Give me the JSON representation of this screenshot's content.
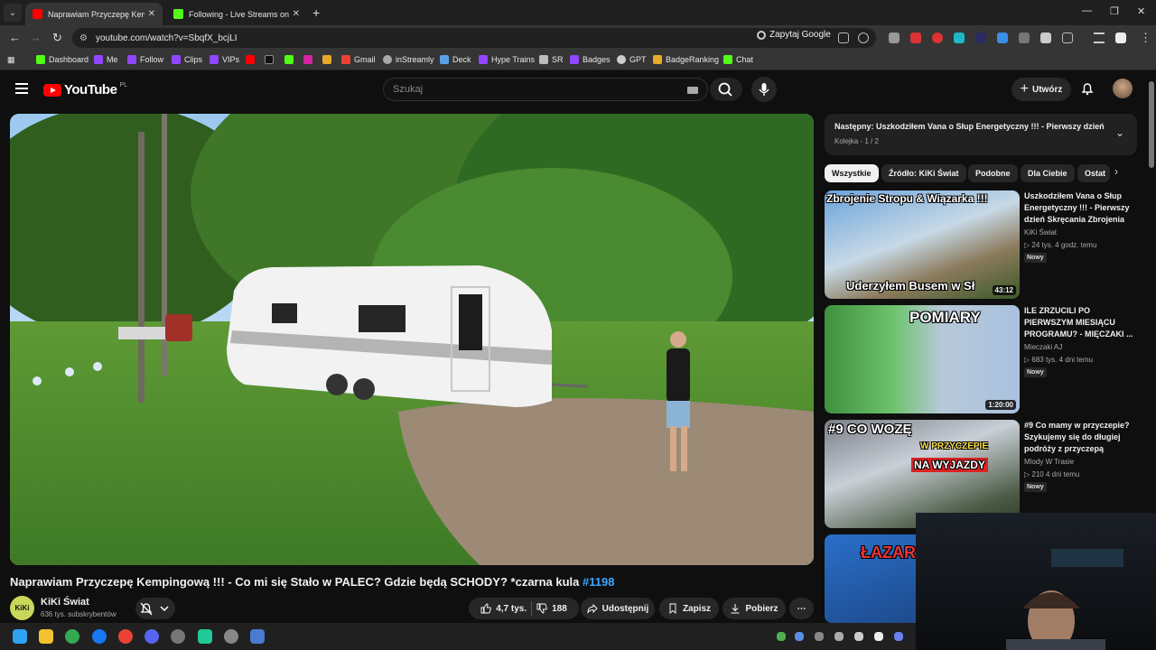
{
  "browser": {
    "tabs": [
      {
        "title": "Naprawiam Przyczepę Kemping",
        "active": true
      },
      {
        "title": "Following - Live Streams on Kic",
        "active": false
      }
    ],
    "url": "youtube.com/watch?v=SbqfX_bcjLI",
    "search_chip": "Zapytaj Google",
    "bookmarks": [
      "Dashboard",
      "Me",
      "Follow",
      "Clips",
      "VIPs",
      "Gmail",
      "inStreamly",
      "Deck",
      "Hype Trains",
      "SR",
      "Badges",
      "GPT",
      "BadgeRanking",
      "Chat"
    ]
  },
  "header": {
    "logo": "YouTube",
    "region": "PL",
    "search_placeholder": "Szukaj",
    "create_label": "Utwórz"
  },
  "video": {
    "title": "Naprawiam Przyczepę Kempingową !!! - Co mi się Stało w PALEC? Gdzie będą SCHODY? *czarna kula",
    "hashtag": "#1198",
    "channel": "KiKi Świat",
    "channel_avatar": "KiKi",
    "subscribers": "636 tys. subskrybentów",
    "likes": "4,7 tys.",
    "dislikes": "188",
    "share": "Udostępnij",
    "save": "Zapisz",
    "download": "Pobierz"
  },
  "queue": {
    "next": "Następny: Uszkodziłem Vana o Słup Energetyczny !!! - Pierwszy dzień ...",
    "position": "Kolejka - 1 / 2"
  },
  "chips": [
    "Wszystkie",
    "Źródło: KiKi Świat",
    "Podobne",
    "Dla Ciebie",
    "Ostat"
  ],
  "recommendations": [
    {
      "title": "Uszkodziłem Vana o Słup Energetyczny !!! - Pierwszy dzień Skręcania Zbrojenia n...",
      "channel": "KiKi Świat",
      "meta": "▷ 24 tys.  4 godz. temu",
      "badge": "Nowy",
      "duration": "43:12",
      "overlay_top": "Zbrojenie Stropu & Wiązarka !!!",
      "overlay_bottom": "Uderzyłem Busem w Sł"
    },
    {
      "title": "ILE ZRZUCILI PO PIERWSZYM MIESIĄCU PROGRAMU? - MIĘCZAKI ...",
      "channel": "Mieczaki AJ",
      "meta": "▷ 683 tys.  4 dni temu",
      "badge": "Nowy",
      "duration": "1:20:00",
      "overlay_top": "POMIARY"
    },
    {
      "title": "#9 Co mamy w przyczepie? Szykujemy się do długiej podróży z przyczepą",
      "channel": "Mlody W Trasie",
      "meta": "▷ 210  4 dni temu",
      "badge": "Nowy",
      "overlay_top": "#9 CO WOZĘ",
      "overlay_mid": "W PRZYCZEPIE",
      "overlay_bottom": "NA WYJAZDY"
    },
    {
      "overlay_top": "ŁAZAR"
    }
  ]
}
